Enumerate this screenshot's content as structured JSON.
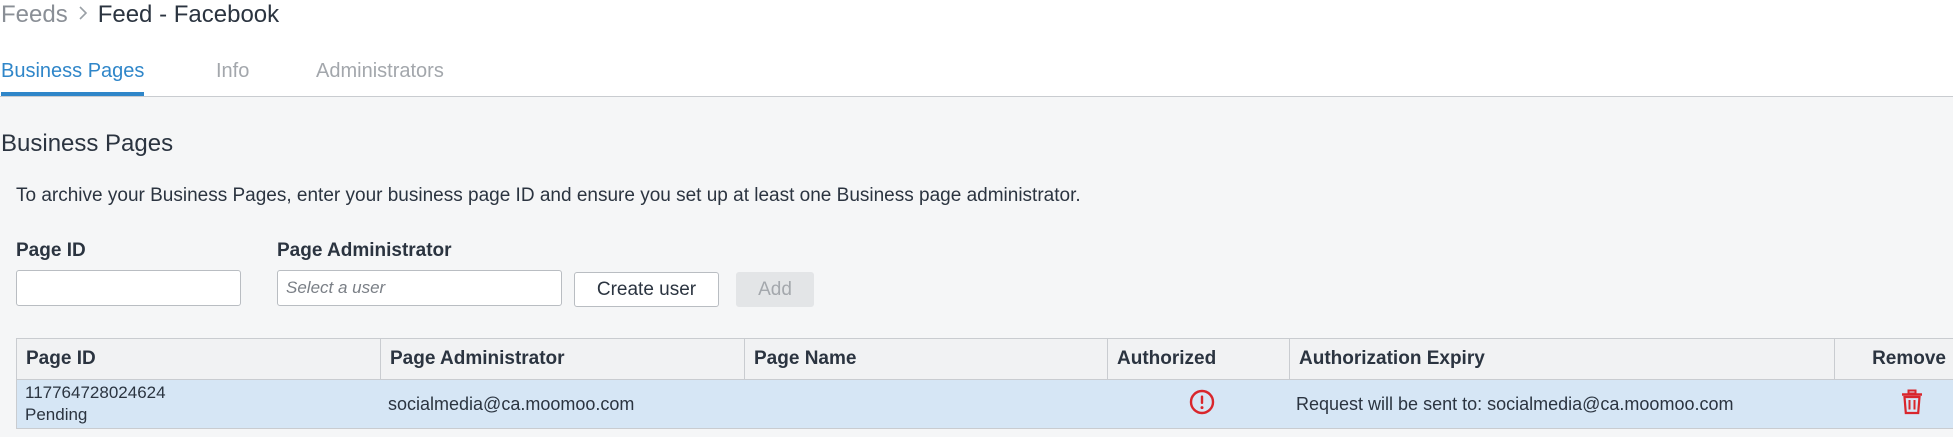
{
  "breadcrumb": {
    "root": "Feeds",
    "separator": ">",
    "current": "Feed - Facebook"
  },
  "tabs": [
    {
      "label": "Business Pages",
      "active": true
    },
    {
      "label": "Info",
      "active": false
    },
    {
      "label": "Administrators",
      "active": false
    }
  ],
  "section": {
    "title": "Business Pages",
    "intro": "To archive your Business Pages, enter your business page ID and ensure you set up at least one Business page administrator."
  },
  "form": {
    "page_id_label": "Page ID",
    "page_id_value": "",
    "admin_label": "Page Administrator",
    "admin_placeholder": "Select a user",
    "create_user_label": "Create user",
    "add_label": "Add",
    "add_disabled": true
  },
  "table": {
    "columns": [
      "Page ID",
      "Page Administrator",
      "Page Name",
      "Authorized",
      "Authorization Expiry",
      "Remove"
    ],
    "rows": [
      {
        "page_id": "117764728024624",
        "status": "Pending",
        "administrator": "socialmedia@ca.moomoo.com",
        "page_name": "",
        "authorized_icon": "alert-circle-icon",
        "expiry": "Request will be sent to: socialmedia@ca.moomoo.com",
        "remove_icon": "trash-icon"
      }
    ]
  },
  "colors": {
    "accent": "#2f86c9",
    "row_highlight": "#d6e6f5",
    "alert": "#d9262c"
  }
}
